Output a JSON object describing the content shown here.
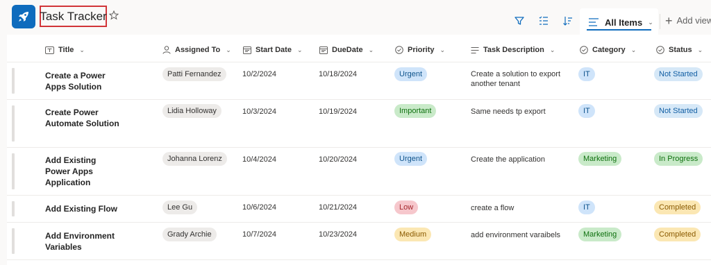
{
  "header": {
    "title": "Task Tracker",
    "tab_label": "All Items",
    "add_view_label": "Add view"
  },
  "columns": [
    {
      "label": "Title",
      "icon": "text-icon"
    },
    {
      "label": "Assigned To",
      "icon": "person-icon"
    },
    {
      "label": "Start Date",
      "icon": "calendar-icon"
    },
    {
      "label": "DueDate",
      "icon": "calendar-icon"
    },
    {
      "label": "Priority",
      "icon": "choice-icon"
    },
    {
      "label": "Task Description",
      "icon": "multiline-text-icon"
    },
    {
      "label": "Category",
      "icon": "choice-icon"
    },
    {
      "label": "Status",
      "icon": "choice-icon"
    }
  ],
  "colors": {
    "urgent": {
      "bg": "#cfe4fa",
      "fg": "#0f548c"
    },
    "important": {
      "bg": "#c9eac9",
      "fg": "#0e700e"
    },
    "low": {
      "bg": "#f6c7cc",
      "fg": "#a4262c"
    },
    "medium": {
      "bg": "#fbe7b3",
      "fg": "#8a5a00"
    },
    "it": {
      "bg": "#cfe4fa",
      "fg": "#0f548c"
    },
    "marketing": {
      "bg": "#c9eac9",
      "fg": "#0e700e"
    },
    "not_started": {
      "bg": "#d6e8f7",
      "fg": "#115ea3"
    },
    "in_progress": {
      "bg": "#c9eac9",
      "fg": "#0e700e"
    },
    "completed": {
      "bg": "#fbe7b3",
      "fg": "#8a5a00"
    }
  },
  "rows": [
    {
      "title": "Create a Power Apps Solution",
      "assigned": "Patti Fernandez",
      "start": "10/2/2024",
      "due": "10/18/2024",
      "priority": "Urgent",
      "description": "Create a solution to export another tenant",
      "category": "IT",
      "status": "Not Started"
    },
    {
      "title": "Create Power Automate Solution",
      "assigned": "Lidia Holloway",
      "start": "10/3/2024",
      "due": "10/19/2024",
      "priority": "Important",
      "description": "Same needs tp export",
      "category": "IT",
      "status": "Not Started"
    },
    {
      "title": "Add Existing Power Apps Application",
      "assigned": "Johanna Lorenz",
      "start": "10/4/2024",
      "due": "10/20/2024",
      "priority": "Urgent",
      "description": "Create the application",
      "category": "Marketing",
      "status": "In Progress"
    },
    {
      "title": "Add Existing Flow",
      "assigned": "Lee Gu",
      "start": "10/6/2024",
      "due": "10/21/2024",
      "priority": "Low",
      "description": "create a flow",
      "category": "IT",
      "status": "Completed"
    },
    {
      "title": "Add Environment Variables",
      "assigned": "Grady Archie",
      "start": "10/7/2024",
      "due": "10/23/2024",
      "priority": "Medium",
      "description": "add environment varaibels",
      "category": "Marketing",
      "status": "Completed"
    }
  ]
}
